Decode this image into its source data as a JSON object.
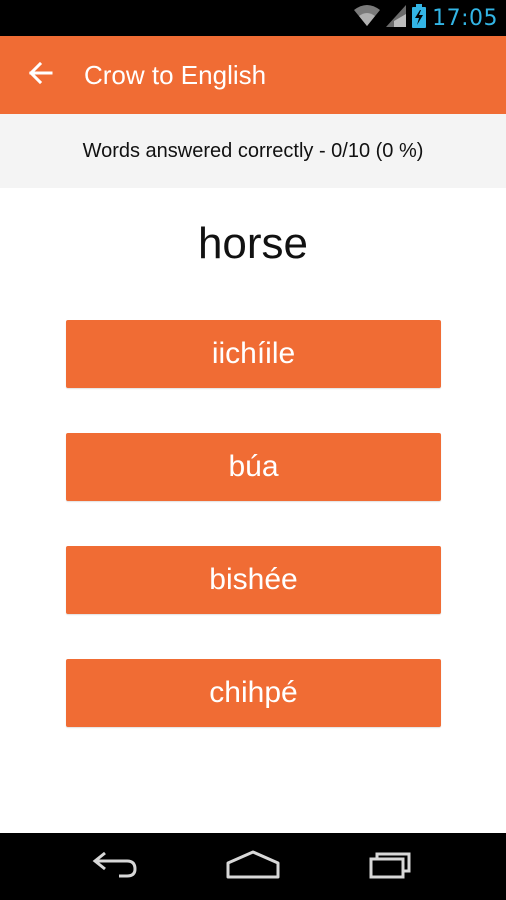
{
  "status_bar": {
    "time": "17:05",
    "icons": [
      "wifi-icon",
      "signal-icon",
      "battery-charging-icon"
    ],
    "accent_color": "#33b5e5"
  },
  "app_bar": {
    "title": "Crow to English",
    "back_icon": "arrow-left-icon",
    "color": "#f06c34"
  },
  "score": {
    "text": "Words answered correctly - 0/10 (0 %)"
  },
  "quiz": {
    "prompt": "horse",
    "answers": [
      {
        "label": "iichíile"
      },
      {
        "label": "búa"
      },
      {
        "label": "bishée"
      },
      {
        "label": "chihpé"
      }
    ]
  },
  "nav_bar": {
    "buttons": [
      "back-icon",
      "home-icon",
      "recent-apps-icon"
    ]
  }
}
